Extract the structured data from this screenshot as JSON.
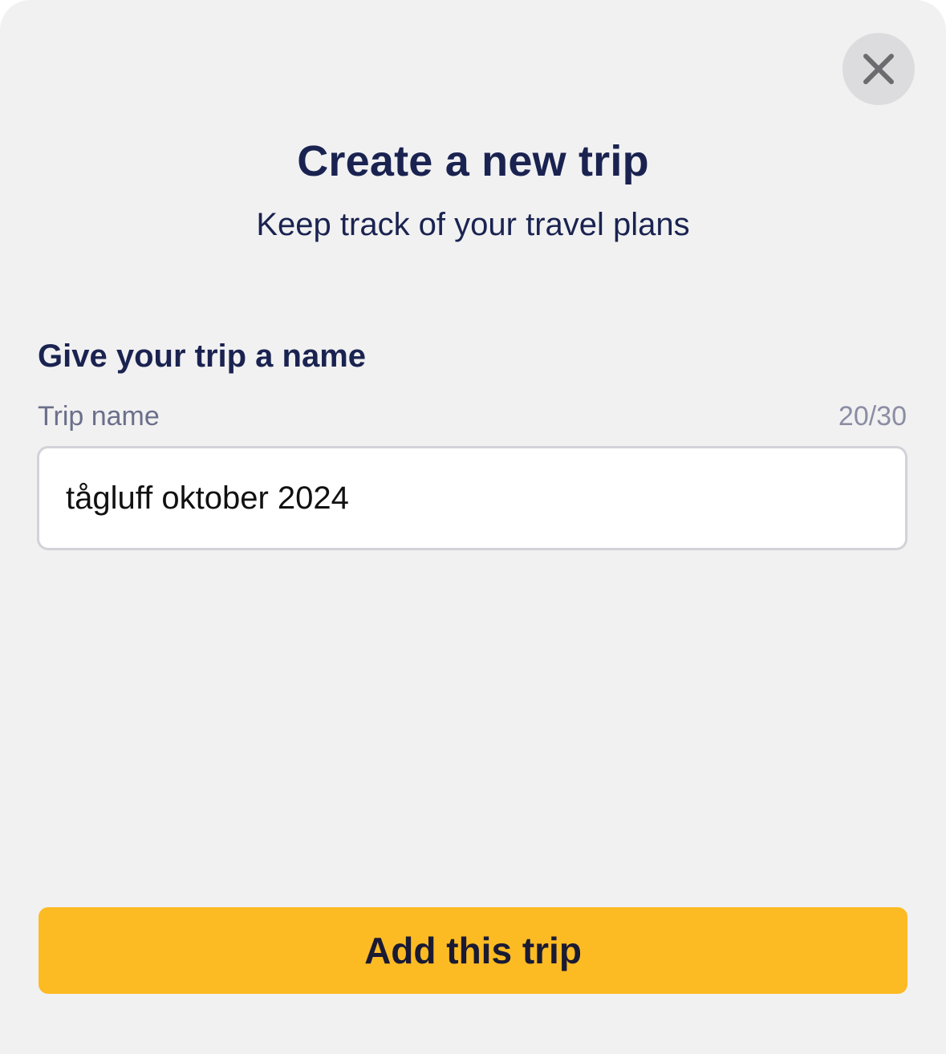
{
  "dialog": {
    "title": "Create a new trip",
    "subtitle": "Keep track of your travel plans",
    "close_icon": "close-icon"
  },
  "form": {
    "section_heading": "Give your trip a name",
    "field_label": "Trip name",
    "char_count": "20/30",
    "trip_name_value": "tågluff oktober 2024"
  },
  "actions": {
    "submit_label": "Add this trip"
  },
  "colors": {
    "background": "#f1f1f2",
    "primary_text": "#1a2350",
    "accent_button": "#fdbb23",
    "close_button_bg": "#dcdcde"
  }
}
